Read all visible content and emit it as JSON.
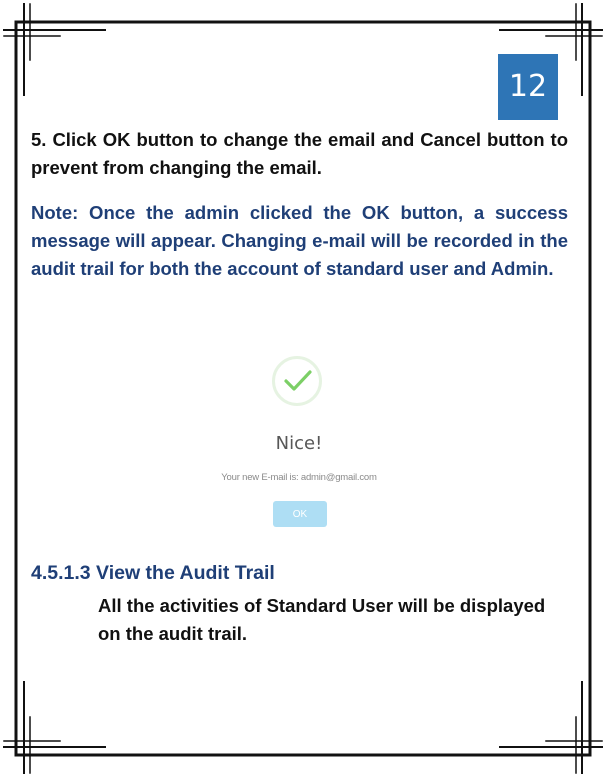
{
  "page_number": "12",
  "step_text": "5. Click OK button to change the email and Cancel button to prevent from changing the email.",
  "note_text": "Note: Once the admin clicked the OK button, a success message will appear. Changing e-mail will be recorded in the audit trail for both the account of standard user and Admin.",
  "dialog": {
    "title": "Nice!",
    "message": "Your new E-mail is: admin@gmail.com",
    "ok_label": "OK"
  },
  "section": {
    "heading": "4.5.1.3 View the Audit Trail",
    "body": "All the activities of Standard User will be displayed on the audit trail."
  },
  "colors": {
    "badge": "#2e75b6",
    "note": "#1f3f77",
    "check": "#7ccf66",
    "ok_button": "#aedef4"
  }
}
